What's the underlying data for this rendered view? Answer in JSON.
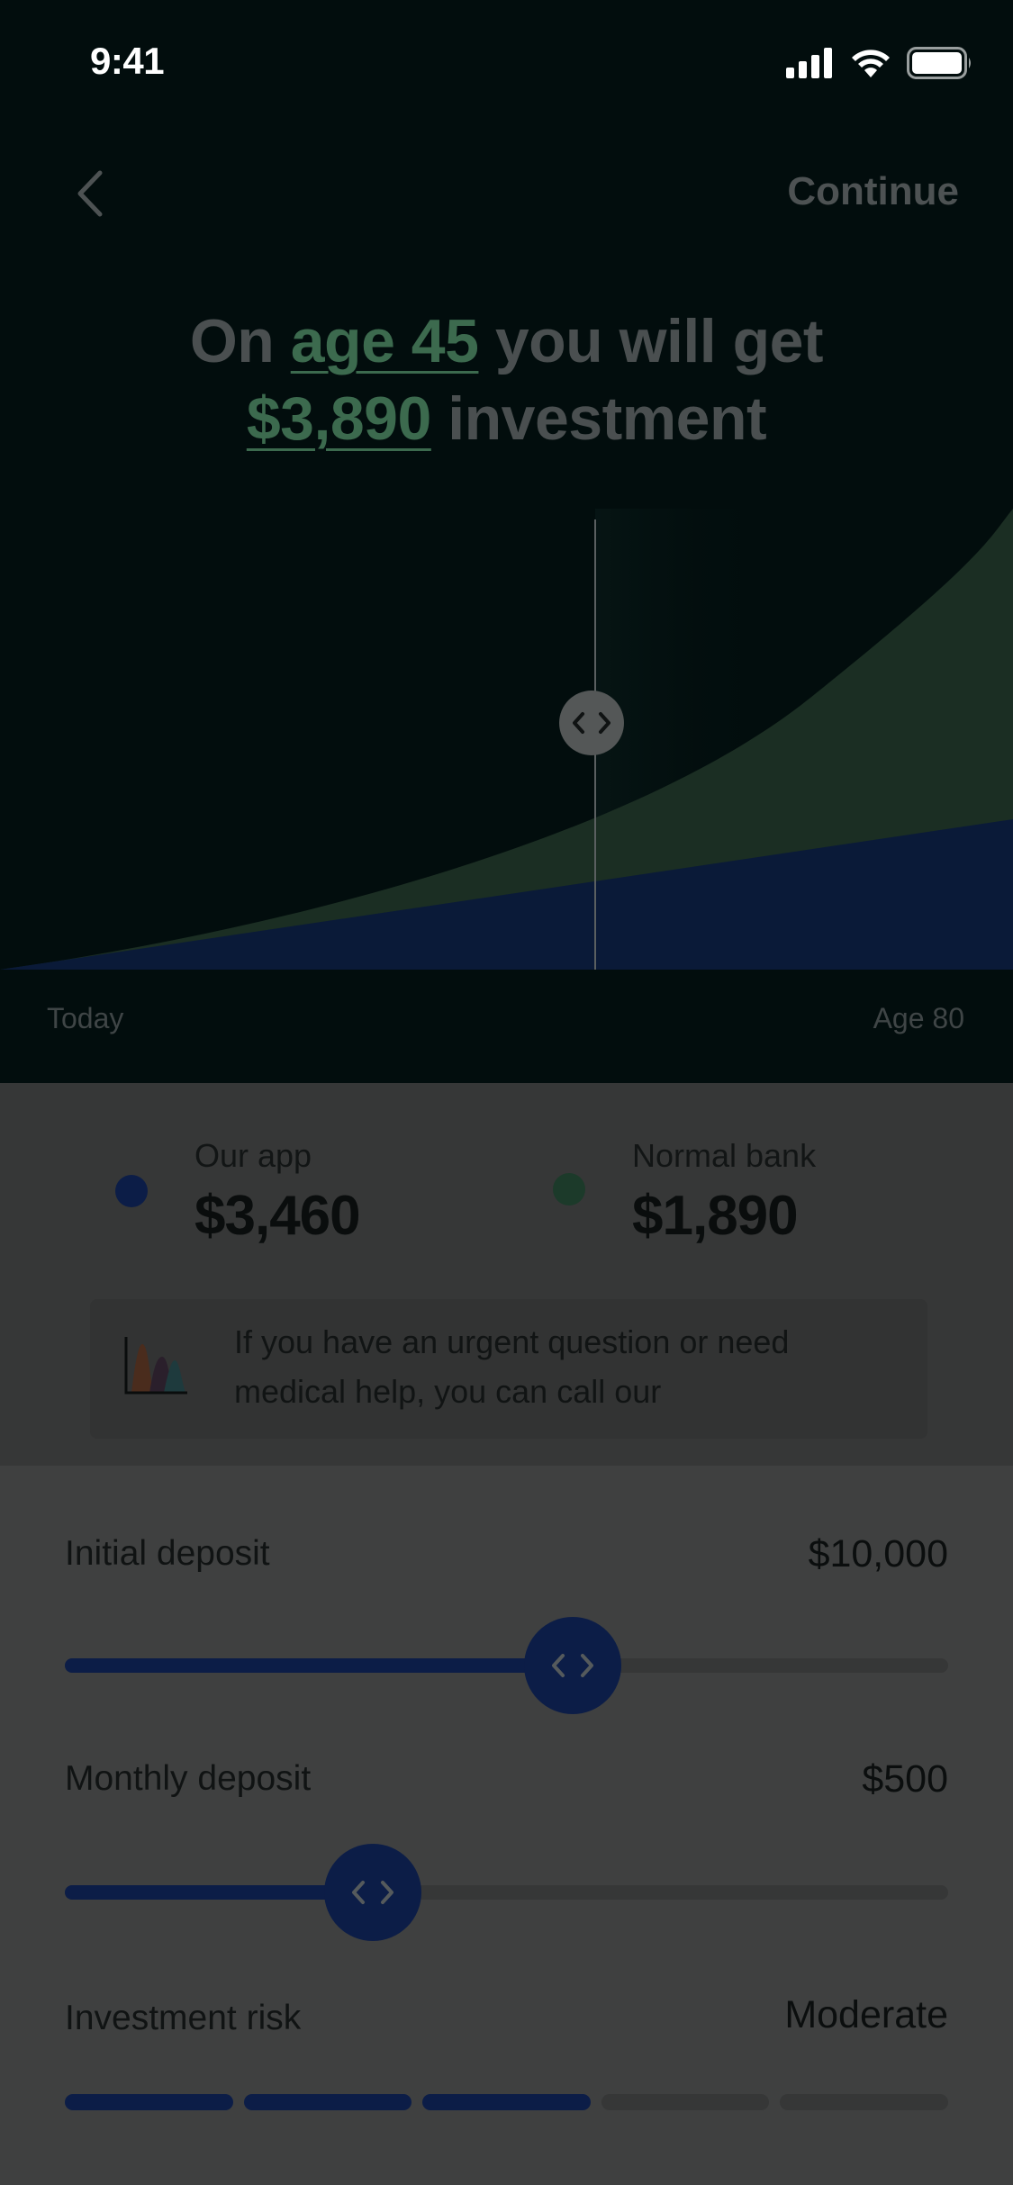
{
  "status_bar": {
    "time": "9:41",
    "icons": [
      "signal-icon",
      "wifi-icon",
      "battery-icon"
    ]
  },
  "nav": {
    "back_icon": "chevron-left-icon",
    "continue_label": "Continue"
  },
  "headline": {
    "part1": "On ",
    "age_link": "age 45",
    "part2": " you will get",
    "amount_link": "$3,890",
    "part3": " investment"
  },
  "chart": {
    "start_label": "Today",
    "end_label": "Age 80",
    "handle_icon": "code-arrows-icon",
    "marker_position_fraction": 0.587,
    "colors": {
      "our_app": "#0a1a38",
      "normal_bank": "#1b2e23",
      "background": "#020d0d"
    }
  },
  "summary": {
    "items": [
      {
        "label": "Our app",
        "value": "$3,460",
        "color": "#0c1d47"
      },
      {
        "label": "Normal bank",
        "value": "$1,890",
        "color": "#1c3a2a"
      }
    ],
    "tip": {
      "icon": "chart-illustration-icon",
      "text": "If you have an urgent question or need medical help, you can call our"
    }
  },
  "controls": {
    "initial_deposit": {
      "label": "Initial deposit",
      "value": "$10,000",
      "fill_fraction": 0.57
    },
    "monthly_deposit": {
      "label": "Monthly deposit",
      "value": "$500",
      "fill_fraction": 0.35
    },
    "investment_risk": {
      "label": "Investment risk",
      "value": "Moderate",
      "level": 3,
      "max_level": 5
    }
  }
}
